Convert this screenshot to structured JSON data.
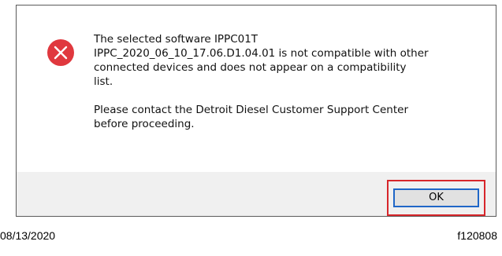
{
  "dialog": {
    "icon": "error-icon",
    "icon_color": "#e0383e",
    "message_line1": "The selected software IPPC01T",
    "message_line2": "IPPC_2020_06_10_17.06.D1.04.01 is not compatible with other",
    "message_line3": "connected devices and does not appear on a compatibility",
    "message_line4": "list.",
    "message_line5": "Please contact the Detroit Diesel Customer Support Center",
    "message_line6": "before proceeding.",
    "ok_label": "OK",
    "highlight_color": "#d7262b"
  },
  "footer": {
    "date": "08/13/2020",
    "figure_id": "f120808"
  }
}
